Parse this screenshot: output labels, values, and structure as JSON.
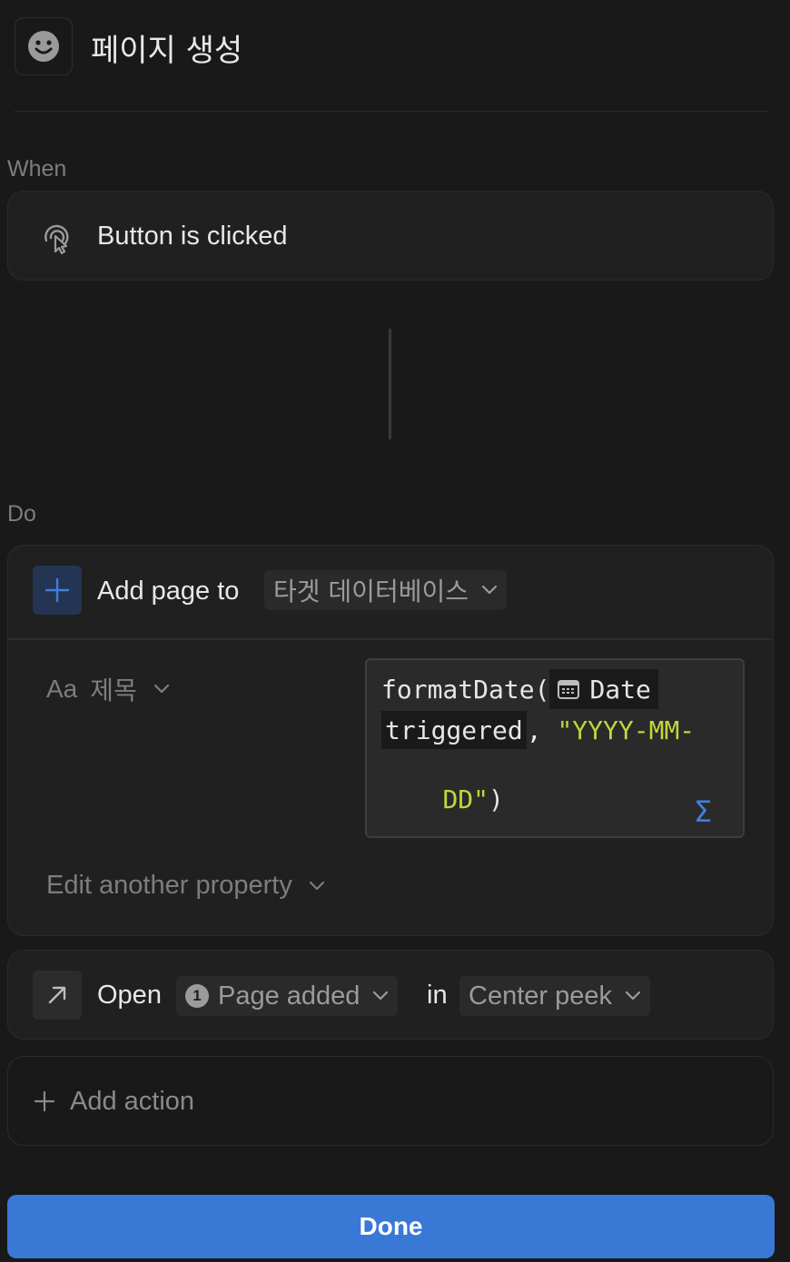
{
  "header": {
    "title": "페이지 생성",
    "icon": "smiley-icon"
  },
  "when": {
    "label": "When",
    "trigger": {
      "text": "Button is clicked",
      "icon": "cursor-click-icon"
    }
  },
  "do": {
    "label": "Do",
    "add_page": {
      "action_label": "Add page to",
      "database": "타겟 데이터베이스",
      "property": {
        "type_label": "Aa",
        "name": "제목"
      },
      "formula": {
        "fn_open": "formatDate(",
        "chip_text": "Date",
        "chip_text2": "triggered",
        "comma": ", ",
        "str_part1": "\"YYYY-MM-",
        "str_part2": "DD\"",
        "close_paren": ")",
        "sigma": "Σ"
      },
      "edit_another": "Edit another property"
    },
    "open": {
      "action_label": "Open",
      "badge_number": "1",
      "target": "Page added",
      "in_label": "in",
      "mode": "Center peek"
    },
    "add_action": "Add action"
  },
  "done_button": "Done",
  "colors": {
    "accent": "#3a78d6",
    "string": "#c2d63c",
    "sigma": "#3f7fe0"
  }
}
